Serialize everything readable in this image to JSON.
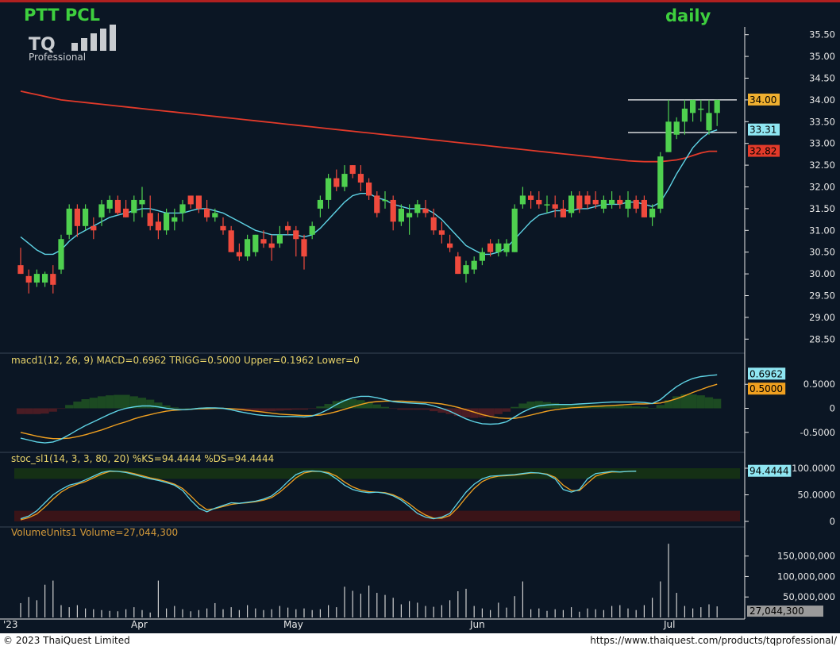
{
  "title": "PTT PCL",
  "period": "daily",
  "logo": {
    "brand": "TQ",
    "sub": "Professional"
  },
  "colors": {
    "background": "#0b1624",
    "up": "#4fd04f",
    "down": "#ef4a3d",
    "ma_fast": "#5fd4e6",
    "ma_slow": "#e23a2a",
    "trigger": "#f0a020",
    "level": "#ffffff"
  },
  "price_panel": {
    "y_ticks": [
      "35.50",
      "35.00",
      "34.50",
      "34.00",
      "33.50",
      "33.00",
      "32.50",
      "32.00",
      "31.50",
      "31.00",
      "30.50",
      "30.00",
      "29.50",
      "29.00",
      "28.50"
    ],
    "tags": {
      "high": "34.00",
      "ma_fast": "33.31",
      "ma_slow": "32.82"
    }
  },
  "macd_panel": {
    "label": "macd1(12, 26, 9) MACD=0.6962 TRIGG=0.5000 Upper=0.1962 Lower=0",
    "y_ticks": [
      "0.5000",
      "0",
      "-0.5000"
    ],
    "tags": {
      "macd": "0.6962",
      "trigger": "0.5000"
    }
  },
  "stoch_panel": {
    "label": "stoc_sl1(14, 3, 3, 80, 20) %KS=94.4444 %DS=94.4444",
    "y_ticks": [
      "100.0000",
      "50.0000",
      "0"
    ],
    "tags": {
      "k": "94.4444"
    }
  },
  "volume_panel": {
    "label": "VolumeUnits1 Volume=27,044,300",
    "y_ticks": [
      "150,000,000",
      "100,000,000",
      "50,000,000"
    ],
    "tags": {
      "volume": "27,044,300"
    }
  },
  "x_axis": {
    "months": [
      "'23",
      "Apr",
      "May",
      "Jun",
      "Jul"
    ]
  },
  "footer": {
    "copyright": "© 2023 ThaiQuest Limited",
    "url": "https://www.thaiquest.com/products/tqprofessional/"
  },
  "chart_data": {
    "type": "candlestick",
    "ohlc": [
      [
        30.2,
        30.6,
        30.0,
        30.0
      ],
      [
        29.95,
        30.1,
        29.55,
        29.8
      ],
      [
        29.8,
        30.1,
        29.7,
        30.0
      ],
      [
        29.8,
        30.05,
        29.7,
        30.0
      ],
      [
        30.0,
        30.2,
        29.55,
        29.75
      ],
      [
        30.1,
        30.9,
        30.0,
        30.8
      ],
      [
        30.9,
        31.6,
        30.8,
        31.5
      ],
      [
        31.5,
        31.6,
        30.85,
        31.1
      ],
      [
        31.1,
        31.6,
        31.0,
        31.5
      ],
      [
        31.1,
        31.3,
        30.8,
        31.0
      ],
      [
        31.3,
        31.7,
        31.1,
        31.6
      ],
      [
        31.5,
        31.8,
        31.4,
        31.7
      ],
      [
        31.7,
        31.8,
        31.35,
        31.4
      ],
      [
        31.5,
        31.7,
        31.3,
        31.3
      ],
      [
        31.4,
        31.8,
        31.2,
        31.7
      ],
      [
        31.6,
        32.0,
        31.3,
        31.7
      ],
      [
        31.4,
        31.8,
        31.0,
        31.1
      ],
      [
        31.2,
        31.4,
        30.8,
        31.0
      ],
      [
        31.0,
        31.5,
        30.9,
        31.4
      ],
      [
        31.2,
        31.5,
        31.0,
        31.3
      ],
      [
        31.4,
        31.7,
        31.2,
        31.6
      ],
      [
        31.8,
        31.8,
        31.5,
        31.6
      ],
      [
        31.8,
        31.8,
        31.4,
        31.5
      ],
      [
        31.5,
        31.7,
        31.2,
        31.3
      ],
      [
        31.3,
        31.5,
        31.2,
        31.4
      ],
      [
        31.1,
        31.3,
        30.9,
        31.0
      ],
      [
        31.0,
        31.1,
        30.5,
        30.5
      ],
      [
        30.5,
        30.7,
        30.3,
        30.4
      ],
      [
        30.4,
        30.9,
        30.3,
        30.8
      ],
      [
        30.5,
        30.9,
        30.4,
        30.9
      ],
      [
        30.8,
        31.0,
        30.6,
        30.7
      ],
      [
        30.7,
        30.9,
        30.3,
        30.6
      ],
      [
        30.7,
        31.1,
        30.6,
        30.9
      ],
      [
        31.1,
        31.2,
        30.9,
        31.0
      ],
      [
        31.0,
        31.1,
        30.4,
        30.8
      ],
      [
        30.8,
        30.9,
        30.1,
        30.4
      ],
      [
        30.9,
        31.2,
        30.8,
        31.1
      ],
      [
        31.5,
        31.8,
        31.3,
        31.7
      ],
      [
        31.7,
        32.3,
        31.5,
        32.2
      ],
      [
        32.2,
        32.4,
        31.9,
        32.0
      ],
      [
        32.0,
        32.5,
        31.9,
        32.3
      ],
      [
        32.5,
        32.5,
        32.2,
        32.3
      ],
      [
        32.3,
        32.5,
        31.9,
        32.1
      ],
      [
        32.1,
        32.2,
        31.7,
        31.8
      ],
      [
        31.8,
        31.9,
        31.3,
        31.4
      ],
      [
        31.7,
        31.9,
        31.5,
        31.7
      ],
      [
        31.7,
        31.8,
        31.0,
        31.2
      ],
      [
        31.2,
        31.6,
        31.1,
        31.5
      ],
      [
        31.3,
        31.6,
        30.9,
        31.4
      ],
      [
        31.4,
        31.7,
        31.3,
        31.6
      ],
      [
        31.5,
        31.7,
        31.3,
        31.4
      ],
      [
        31.3,
        31.5,
        30.9,
        31.0
      ],
      [
        31.0,
        31.2,
        30.7,
        30.9
      ],
      [
        30.7,
        30.9,
        30.5,
        30.6
      ],
      [
        30.4,
        30.5,
        30.0,
        30.0
      ],
      [
        30.0,
        30.3,
        29.8,
        30.2
      ],
      [
        30.1,
        30.4,
        30.0,
        30.3
      ],
      [
        30.3,
        30.6,
        30.2,
        30.5
      ],
      [
        30.7,
        30.8,
        30.4,
        30.5
      ],
      [
        30.5,
        30.8,
        30.4,
        30.7
      ],
      [
        30.5,
        30.8,
        30.4,
        30.7
      ],
      [
        30.5,
        31.6,
        30.5,
        31.5
      ],
      [
        31.6,
        32.0,
        31.5,
        31.8
      ],
      [
        31.8,
        31.9,
        31.5,
        31.7
      ],
      [
        31.7,
        31.9,
        31.5,
        31.6
      ],
      [
        31.6,
        31.8,
        31.4,
        31.6
      ],
      [
        31.6,
        31.8,
        31.3,
        31.5
      ],
      [
        31.5,
        31.7,
        31.3,
        31.3
      ],
      [
        31.4,
        31.9,
        31.3,
        31.8
      ],
      [
        31.8,
        31.9,
        31.4,
        31.5
      ],
      [
        31.8,
        31.9,
        31.5,
        31.6
      ],
      [
        31.7,
        31.9,
        31.5,
        31.6
      ],
      [
        31.5,
        31.8,
        31.4,
        31.7
      ],
      [
        31.6,
        31.9,
        31.5,
        31.7
      ],
      [
        31.7,
        31.8,
        31.5,
        31.6
      ],
      [
        31.5,
        31.9,
        31.3,
        31.7
      ],
      [
        31.7,
        31.8,
        31.4,
        31.5
      ],
      [
        31.7,
        31.8,
        31.3,
        31.3
      ],
      [
        31.3,
        31.6,
        31.1,
        31.5
      ],
      [
        31.5,
        32.8,
        31.4,
        32.7
      ],
      [
        32.8,
        34.0,
        32.8,
        33.5
      ],
      [
        33.2,
        33.6,
        33.1,
        33.5
      ],
      [
        33.5,
        34.0,
        33.2,
        33.8
      ],
      [
        33.7,
        34.0,
        33.5,
        34.0
      ],
      [
        33.8,
        34.0,
        33.5,
        33.8
      ],
      [
        33.3,
        34.0,
        33.2,
        33.7
      ],
      [
        33.7,
        34.0,
        33.4,
        34.0
      ]
    ],
    "ma_fast": [
      30.85,
      30.7,
      30.55,
      30.45,
      30.45,
      30.55,
      30.75,
      30.9,
      31.0,
      31.1,
      31.2,
      31.3,
      31.35,
      31.4,
      31.45,
      31.5,
      31.5,
      31.45,
      31.4,
      31.4,
      31.4,
      31.45,
      31.5,
      31.5,
      31.45,
      31.4,
      31.3,
      31.2,
      31.1,
      31.0,
      30.95,
      30.9,
      30.9,
      30.9,
      30.9,
      30.85,
      30.9,
      31.05,
      31.25,
      31.45,
      31.65,
      31.8,
      31.85,
      31.85,
      31.75,
      31.7,
      31.6,
      31.55,
      31.5,
      31.5,
      31.5,
      31.4,
      31.25,
      31.05,
      30.85,
      30.65,
      30.55,
      30.45,
      30.45,
      30.5,
      30.6,
      30.8,
      31.0,
      31.2,
      31.35,
      31.4,
      31.45,
      31.45,
      31.45,
      31.5,
      31.5,
      31.55,
      31.6,
      31.6,
      31.6,
      31.65,
      31.65,
      31.6,
      31.55,
      31.65,
      31.95,
      32.3,
      32.6,
      32.9,
      33.1,
      33.25,
      33.31
    ],
    "ma_slow": [
      34.2,
      34.16,
      34.12,
      34.08,
      34.04,
      34.0,
      33.98,
      33.96,
      33.94,
      33.92,
      33.9,
      33.88,
      33.86,
      33.84,
      33.82,
      33.8,
      33.78,
      33.76,
      33.74,
      33.72,
      33.7,
      33.68,
      33.66,
      33.64,
      33.62,
      33.6,
      33.58,
      33.56,
      33.54,
      33.52,
      33.5,
      33.48,
      33.46,
      33.44,
      33.42,
      33.4,
      33.38,
      33.36,
      33.34,
      33.32,
      33.3,
      33.28,
      33.26,
      33.24,
      33.22,
      33.2,
      33.18,
      33.16,
      33.14,
      33.12,
      33.1,
      33.08,
      33.06,
      33.04,
      33.02,
      33.0,
      32.98,
      32.96,
      32.94,
      32.92,
      32.9,
      32.88,
      32.86,
      32.84,
      32.82,
      32.8,
      32.78,
      32.76,
      32.74,
      32.72,
      32.7,
      32.68,
      32.66,
      32.64,
      32.62,
      32.6,
      32.59,
      32.58,
      32.58,
      32.58,
      32.6,
      32.62,
      32.66,
      32.72,
      32.78,
      32.82,
      32.82
    ],
    "levels": [
      34.0,
      33.25
    ],
    "price_ylim": [
      28.25,
      35.75
    ],
    "macd": [
      -0.62,
      -0.66,
      -0.7,
      -0.72,
      -0.7,
      -0.64,
      -0.55,
      -0.45,
      -0.36,
      -0.28,
      -0.2,
      -0.12,
      -0.05,
      0.0,
      0.03,
      0.05,
      0.05,
      0.03,
      0.0,
      -0.02,
      -0.03,
      -0.02,
      0.0,
      0.01,
      0.01,
      0.0,
      -0.03,
      -0.07,
      -0.1,
      -0.13,
      -0.15,
      -0.16,
      -0.17,
      -0.17,
      -0.17,
      -0.18,
      -0.16,
      -0.1,
      -0.02,
      0.08,
      0.16,
      0.22,
      0.25,
      0.25,
      0.22,
      0.18,
      0.14,
      0.12,
      0.11,
      0.1,
      0.09,
      0.05,
      0.0,
      -0.06,
      -0.14,
      -0.22,
      -0.28,
      -0.32,
      -0.33,
      -0.32,
      -0.28,
      -0.18,
      -0.08,
      0.0,
      0.05,
      0.07,
      0.08,
      0.08,
      0.08,
      0.09,
      0.1,
      0.11,
      0.12,
      0.13,
      0.13,
      0.13,
      0.13,
      0.12,
      0.1,
      0.18,
      0.32,
      0.45,
      0.55,
      0.62,
      0.66,
      0.68,
      0.6962
    ],
    "trigger": [
      -0.5,
      -0.54,
      -0.58,
      -0.61,
      -0.63,
      -0.63,
      -0.62,
      -0.59,
      -0.55,
      -0.5,
      -0.45,
      -0.39,
      -0.33,
      -0.28,
      -0.22,
      -0.17,
      -0.13,
      -0.09,
      -0.06,
      -0.04,
      -0.03,
      -0.02,
      -0.01,
      -0.01,
      0.0,
      0.0,
      -0.01,
      -0.02,
      -0.04,
      -0.06,
      -0.08,
      -0.1,
      -0.12,
      -0.13,
      -0.14,
      -0.15,
      -0.15,
      -0.14,
      -0.11,
      -0.07,
      -0.02,
      0.03,
      0.08,
      0.12,
      0.14,
      0.15,
      0.15,
      0.15,
      0.14,
      0.13,
      0.12,
      0.11,
      0.09,
      0.06,
      0.02,
      -0.03,
      -0.08,
      -0.13,
      -0.17,
      -0.2,
      -0.21,
      -0.21,
      -0.18,
      -0.14,
      -0.1,
      -0.06,
      -0.03,
      -0.01,
      0.01,
      0.02,
      0.03,
      0.04,
      0.05,
      0.06,
      0.07,
      0.08,
      0.09,
      0.09,
      0.1,
      0.11,
      0.15,
      0.2,
      0.26,
      0.33,
      0.39,
      0.45,
      0.5
    ],
    "macd_ylim": [
      -0.85,
      0.85
    ],
    "stoch_k": [
      5,
      10,
      20,
      35,
      50,
      60,
      68,
      72,
      78,
      85,
      92,
      95,
      94,
      92,
      88,
      84,
      80,
      77,
      73,
      68,
      58,
      40,
      25,
      18,
      25,
      30,
      35,
      34,
      36,
      38,
      42,
      48,
      60,
      75,
      88,
      94,
      95,
      94,
      90,
      80,
      68,
      60,
      56,
      54,
      55,
      53,
      48,
      40,
      28,
      15,
      8,
      5,
      8,
      15,
      35,
      55,
      70,
      80,
      85,
      86,
      87,
      88,
      90,
      92,
      91,
      88,
      80,
      60,
      55,
      60,
      80,
      90,
      92,
      94,
      93,
      94,
      94.4444
    ],
    "stoch_d": [
      3,
      7,
      14,
      27,
      42,
      55,
      64,
      70,
      75,
      82,
      89,
      94,
      94,
      93,
      90,
      86,
      82,
      79,
      75,
      70,
      62,
      48,
      33,
      22,
      24,
      28,
      32,
      34,
      35,
      37,
      40,
      45,
      55,
      68,
      82,
      91,
      94,
      94,
      92,
      85,
      74,
      65,
      59,
      56,
      55,
      54,
      50,
      43,
      33,
      21,
      12,
      6,
      6,
      11,
      26,
      45,
      62,
      75,
      82,
      85,
      86,
      87,
      89,
      91,
      91,
      89,
      83,
      68,
      58,
      58,
      72,
      85,
      90,
      93,
      93,
      94,
      94.4444
    ],
    "stoch_ylim": [
      0,
      100
    ],
    "volume": [
      35,
      50,
      42,
      80,
      90,
      30,
      25,
      30,
      22,
      20,
      18,
      16,
      15,
      20,
      25,
      18,
      12,
      90,
      22,
      28,
      20,
      15,
      18,
      22,
      35,
      20,
      25,
      18,
      30,
      22,
      18,
      20,
      28,
      24,
      20,
      22,
      18,
      20,
      30,
      25,
      75,
      65,
      58,
      78,
      60,
      55,
      48,
      32,
      40,
      36,
      28,
      26,
      30,
      42,
      64,
      70,
      28,
      22,
      18,
      36,
      24,
      52,
      88,
      20,
      22,
      16,
      20,
      18,
      25,
      14,
      22,
      20,
      18,
      28,
      30,
      22,
      18,
      30,
      48,
      88,
      180,
      60,
      28,
      22,
      25,
      32,
      27.0443
    ],
    "volume_unit": "millions",
    "volume_ylim": [
      0,
      190
    ]
  }
}
